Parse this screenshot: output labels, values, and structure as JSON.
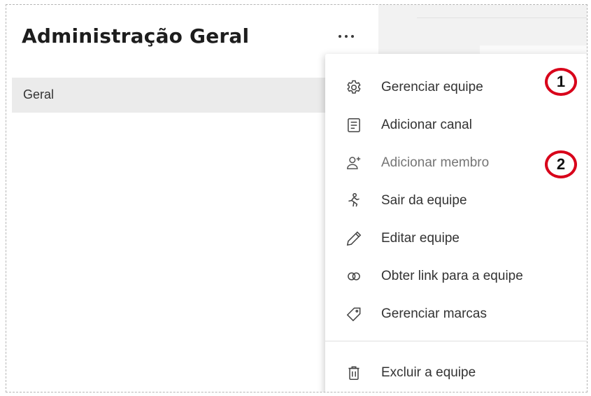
{
  "team": {
    "name": "Administração Geral",
    "more_icon": "more-horizontal-icon"
  },
  "channels": [
    {
      "label": "Geral"
    }
  ],
  "menu": {
    "items": [
      {
        "label": "Gerenciar equipe",
        "icon": "gear-icon"
      },
      {
        "label": "Adicionar canal",
        "icon": "add-channel-icon"
      },
      {
        "label": "Adicionar membro",
        "icon": "add-person-icon"
      },
      {
        "label": "Sair da equipe",
        "icon": "leave-team-icon"
      },
      {
        "label": "Editar equipe",
        "icon": "pencil-icon"
      },
      {
        "label": "Obter link para a equipe",
        "icon": "link-icon"
      },
      {
        "label": "Gerenciar marcas",
        "icon": "tag-icon"
      },
      {
        "label": "Excluir a equipe",
        "icon": "trash-icon"
      }
    ]
  },
  "annotations": [
    {
      "label": "1",
      "color": "#d8001a"
    },
    {
      "label": "2",
      "color": "#d8001a"
    }
  ]
}
